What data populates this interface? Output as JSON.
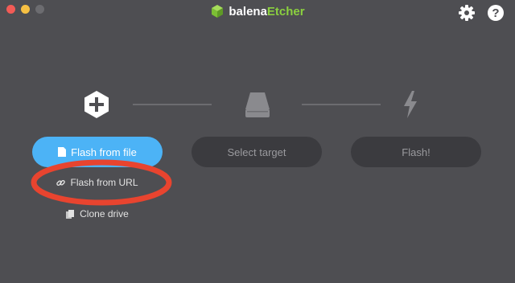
{
  "window": {
    "controls": [
      "close",
      "minimize",
      "maximize"
    ],
    "colors": {
      "close": "#f25b56",
      "minimize": "#f6c043",
      "maximize": "#6c6c70"
    }
  },
  "header": {
    "brand_prefix": "balena",
    "brand_suffix": "Etcher",
    "logo_icon": "cube-logo-icon",
    "settings_icon": "gear-icon",
    "help_icon": "help-icon"
  },
  "steps": {
    "source_icon": "plus-hexagon-icon",
    "target_icon": "drive-icon",
    "flash_icon": "lightning-bolt-icon",
    "flash_from_file_label": "Flash from file",
    "select_target_label": "Select target",
    "flash_label": "Flash!"
  },
  "source_options": {
    "flash_from_url_label": "Flash from URL",
    "clone_drive_label": "Clone drive"
  },
  "colors": {
    "background": "#4e4e52",
    "accent": "#4cb3f6",
    "brand_green": "#8bd03f",
    "disabled_button": "#3b3b3f",
    "annotation": "#e8442f"
  }
}
